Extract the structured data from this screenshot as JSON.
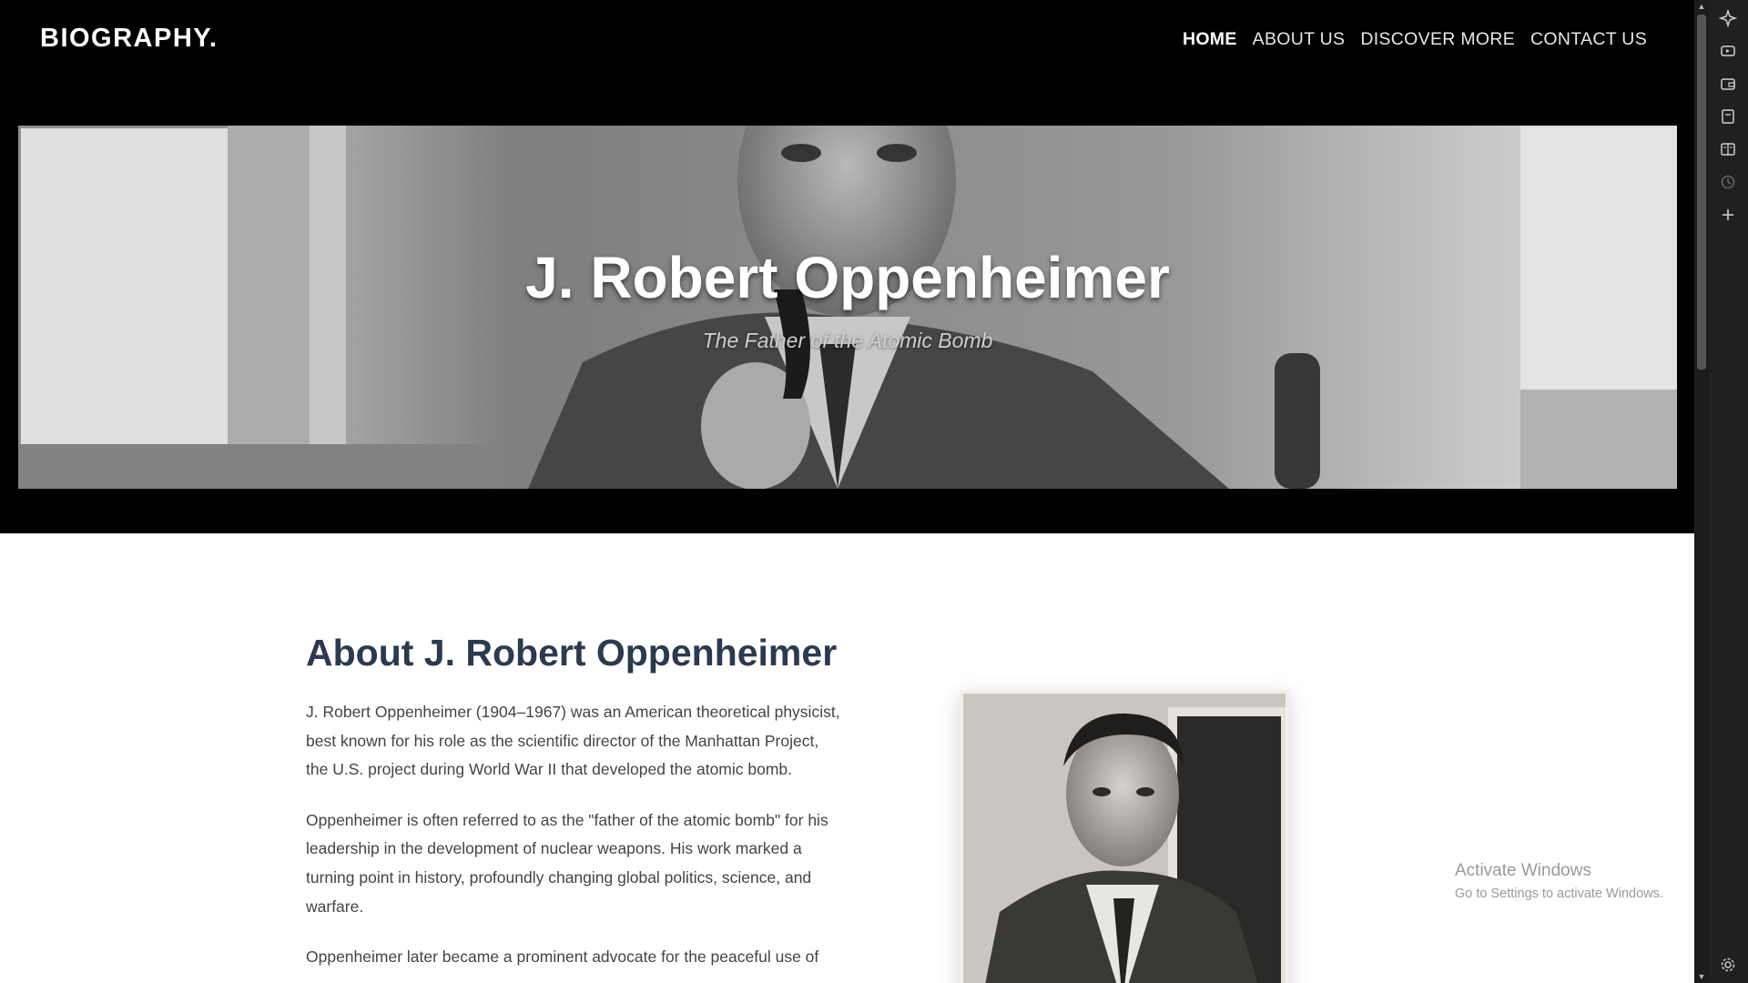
{
  "header": {
    "logo": "BIOGRAPHY.",
    "nav": [
      {
        "label": "HOME",
        "active": true
      },
      {
        "label": "ABOUT US",
        "active": false
      },
      {
        "label": "DISCOVER MORE",
        "active": false
      },
      {
        "label": "CONTACT US",
        "active": false
      }
    ]
  },
  "hero": {
    "title": "J. Robert Oppenheimer",
    "subtitle": "The Father of the Atomic Bomb"
  },
  "about": {
    "title": "About J. Robert Oppenheimer",
    "paragraphs": [
      "J. Robert Oppenheimer (1904–1967) was an American theoretical physicist, best known for his role as the scientific director of the Manhattan Project, the U.S. project during World War II that developed the atomic bomb.",
      "Oppenheimer is often referred to as the \"father of the atomic bomb\" for his leadership in the development of nuclear weapons. His work marked a turning point in history, profoundly changing global politics, science, and warfare.",
      "Oppenheimer later became a prominent advocate for the peaceful use of"
    ]
  },
  "watermark": {
    "line1": "Activate Windows",
    "line2": "Go to Settings to activate Windows."
  },
  "sidepanel": {
    "icons": [
      "copilot-icon",
      "media-icon",
      "wallet-icon",
      "collections-icon",
      "reading-list-icon",
      "history-icon",
      "add-icon",
      "settings-icon"
    ]
  },
  "colors": {
    "header_bg": "#000000",
    "heading": "#2b3a4e",
    "body_text": "#444444"
  }
}
